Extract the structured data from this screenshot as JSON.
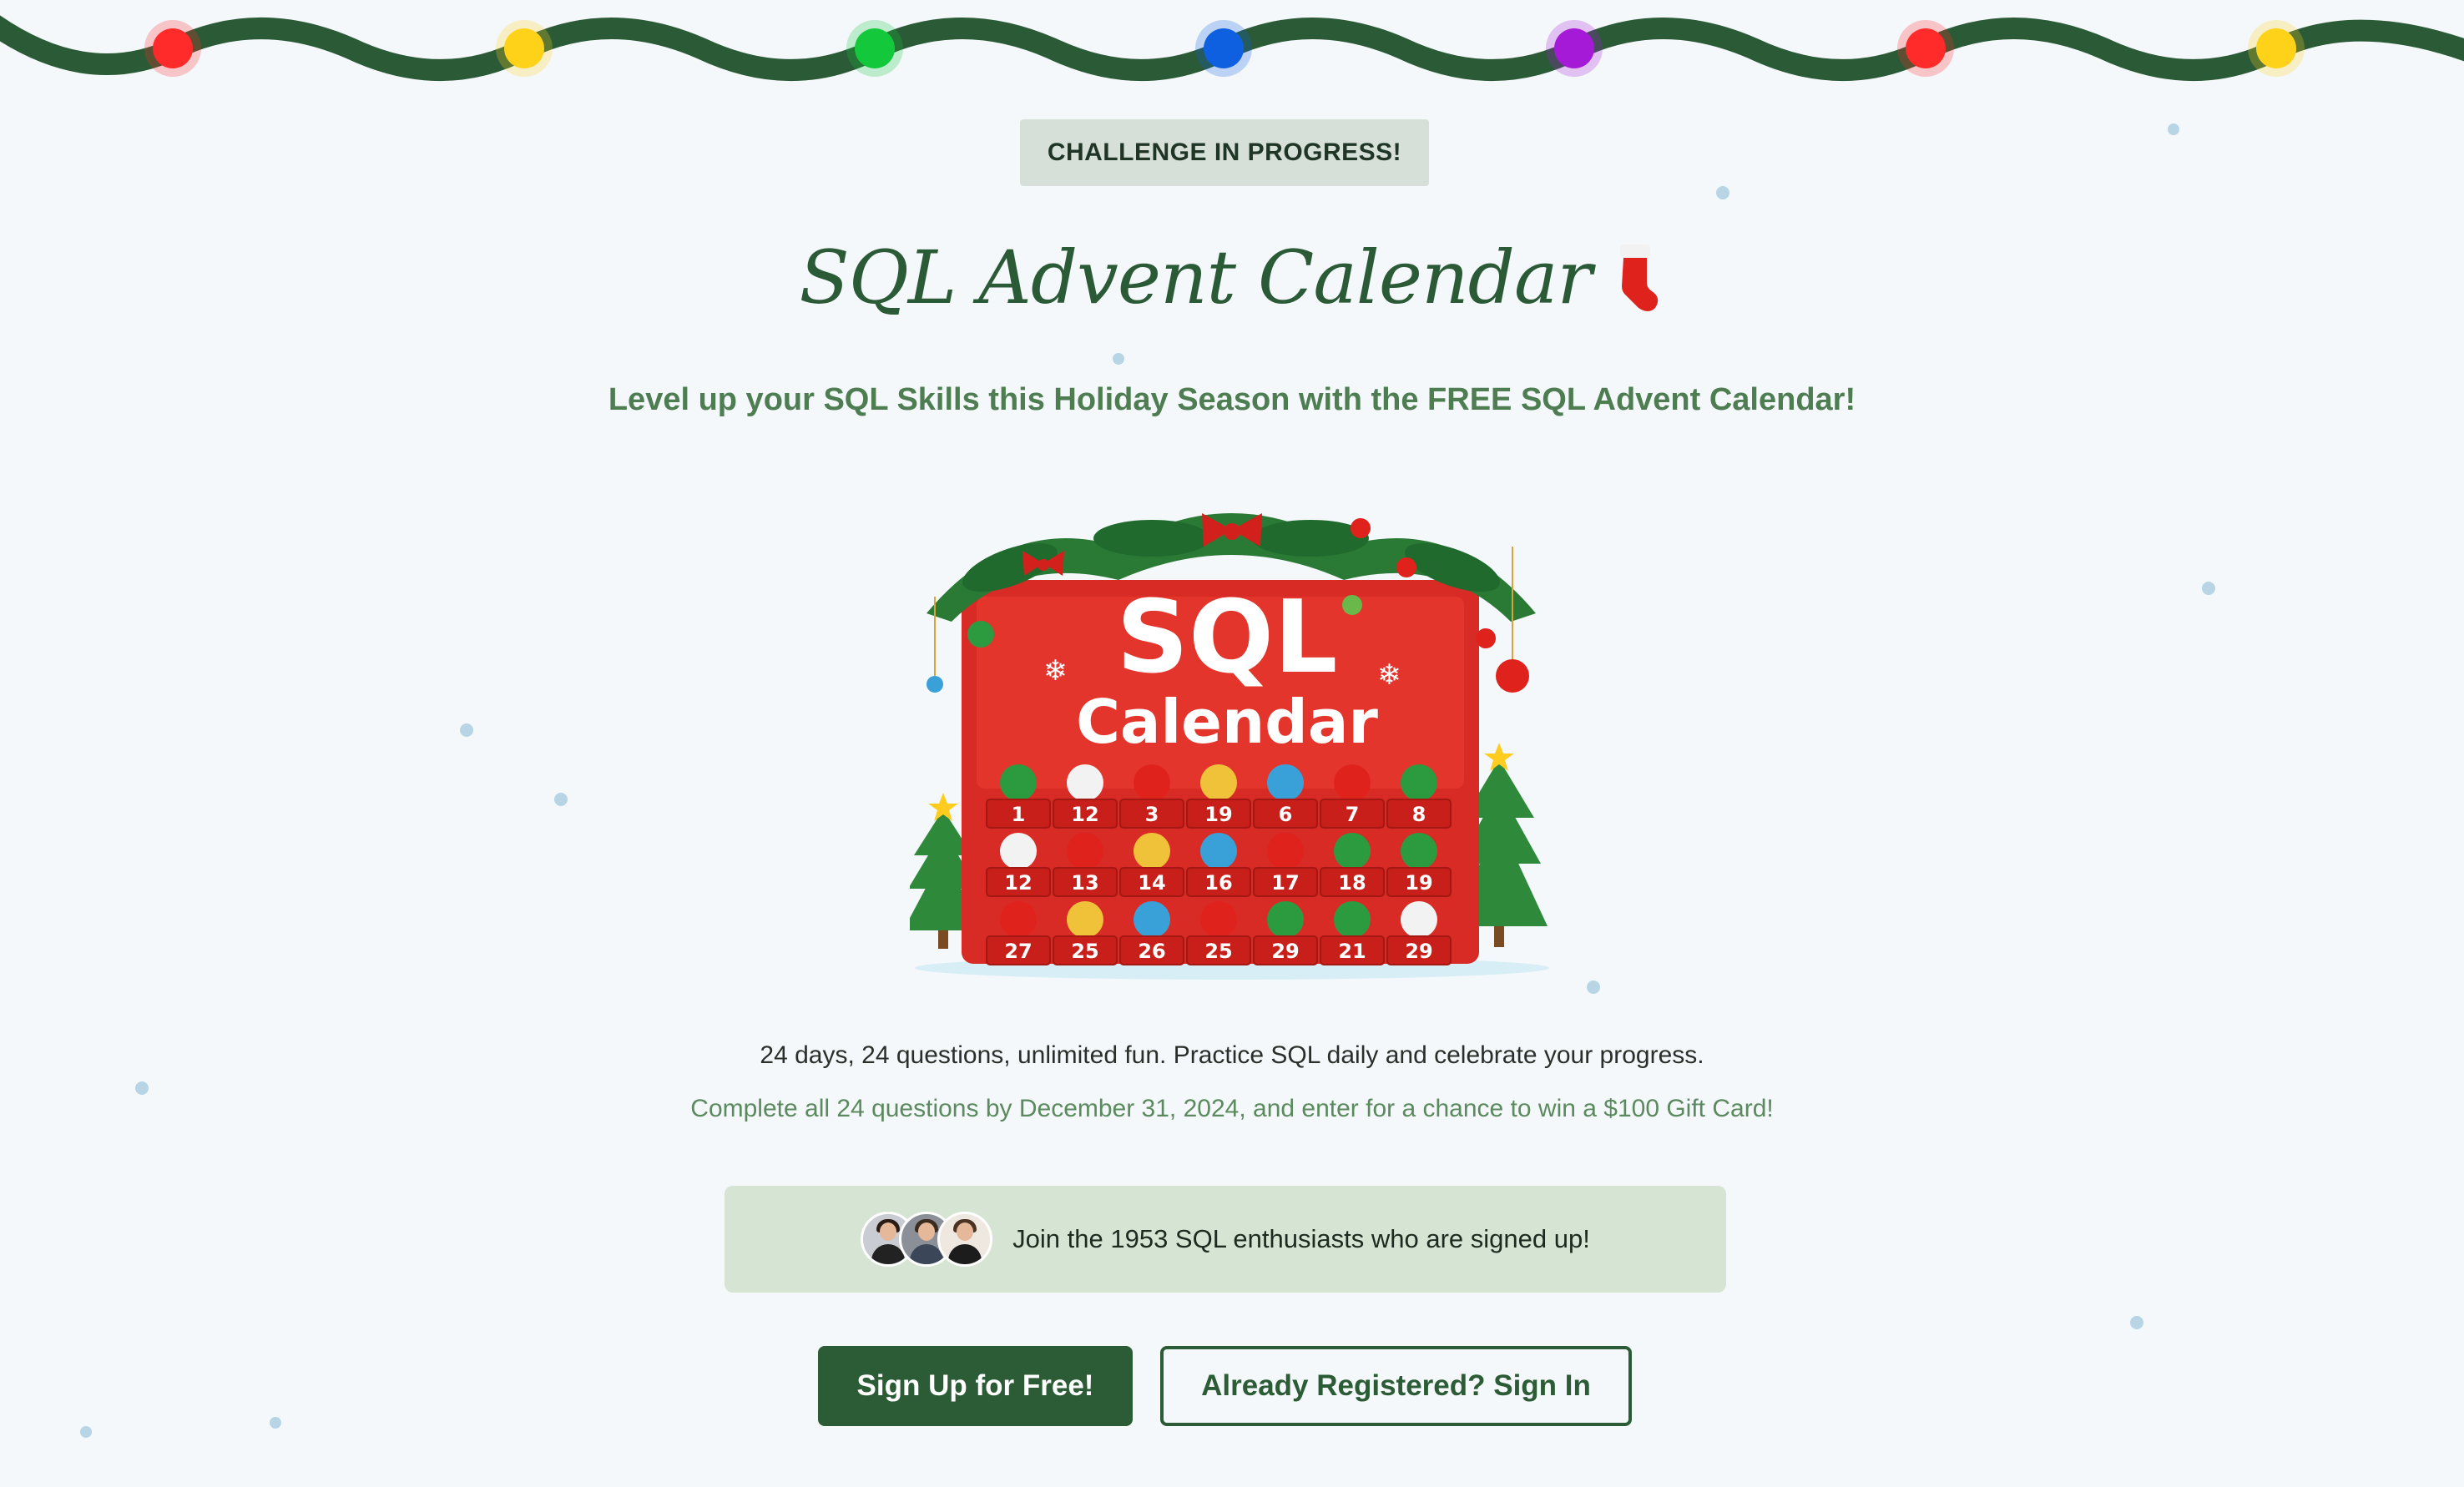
{
  "header": {
    "badge": "CHALLENGE IN PROGRESS!",
    "title": "SQL Advent Calendar",
    "title_icon": "stocking-icon",
    "subtitle": "Level up your SQL Skills this Holiday Season with the FREE SQL Advent Calendar!"
  },
  "garland": {
    "bulb_colors": [
      "#ff2a2a",
      "#ffd21a",
      "#14c83c",
      "#0f60e0",
      "#a41ad6",
      "#ff2a2a",
      "#ffd21a"
    ]
  },
  "hero": {
    "title_line1": "SQL",
    "title_line2": "Calendar",
    "days": [
      "1",
      "12",
      "3",
      "19",
      "6",
      "7",
      "8",
      "12",
      "13",
      "14",
      "16",
      "17",
      "18",
      "19",
      "27",
      "25",
      "26",
      "25",
      "29",
      "21",
      "29"
    ]
  },
  "intro": {
    "line1": "24 days, 24 questions, unlimited fun. Practice SQL daily and celebrate your progress.",
    "line2": "Complete all 24 questions by December 31, 2024, and enter for a chance to win a $100 Gift Card!"
  },
  "signup_banner": {
    "text": "Join the 1953 SQL enthusiasts who are signed up!"
  },
  "actions": {
    "signup_label": "Sign Up for Free!",
    "signin_label": "Already Registered? Sign In"
  },
  "colors": {
    "brand_green": "#2c5c35",
    "accent_green": "#4e7d52",
    "background": "#f4f8fb"
  }
}
